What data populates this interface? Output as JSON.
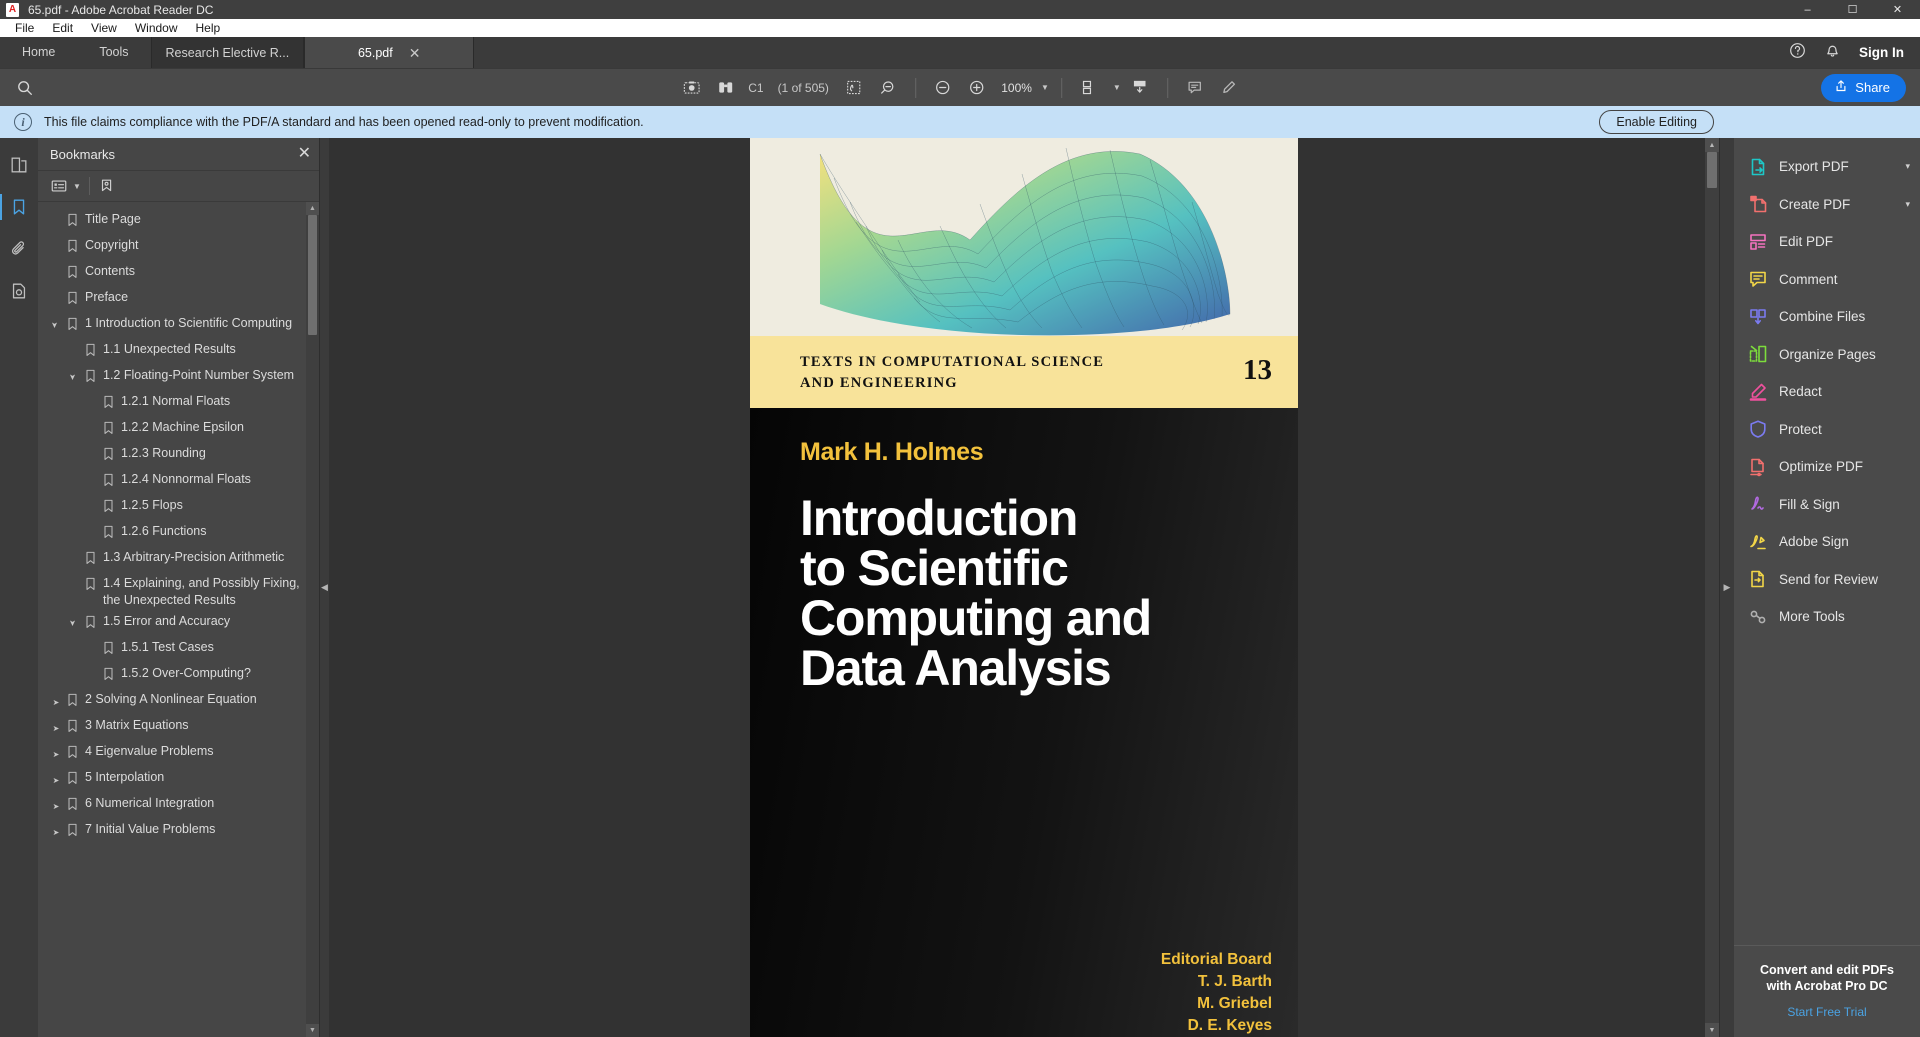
{
  "window": {
    "title": "65.pdf - Adobe Acrobat Reader DC",
    "app_icon": "adobe-acrobat-icon",
    "minimize": "–",
    "maximize": "☐",
    "close": "✕"
  },
  "menubar": {
    "items": [
      {
        "label": "File"
      },
      {
        "label": "Edit"
      },
      {
        "label": "View"
      },
      {
        "label": "Window"
      },
      {
        "label": "Help"
      }
    ]
  },
  "tabs": {
    "home": "Home",
    "tools": "Tools",
    "documents": [
      {
        "label": "Research Elective R...",
        "active": false
      },
      {
        "label": "65.pdf",
        "active": true,
        "close": "✕"
      }
    ],
    "help_icon": "question-circle-icon",
    "bell_icon": "notification-bell-icon",
    "signin": "Sign In"
  },
  "toolbar": {
    "search_icon": "search-icon",
    "snapshot_icon": "camera-snapshot-icon",
    "read_mode_icon": "binoculars-icon",
    "page_label": "C1",
    "page_count": "(1 of 505)",
    "pan_icon": "pan-select-icon",
    "zoom_select_icon": "marquee-zoom-icon",
    "zoom_out_icon": "zoom-out-icon",
    "zoom_in_icon": "zoom-in-icon",
    "zoom_value": "100%",
    "zoom_caret": "▼",
    "fit_icon": "fit-page-icon",
    "fit_caret": "▼",
    "scroll_icon": "scroll-mode-icon",
    "comment_icon": "comment-icon",
    "highlight_icon": "highlighter-icon",
    "share_icon": "share-icon",
    "share_label": "Share"
  },
  "notification": {
    "icon": "info-icon",
    "info_glyph": "i",
    "message": "This file claims compliance with the PDF/A standard and has been opened read-only to prevent modification.",
    "action_label": "Enable Editing"
  },
  "rail": {
    "items": [
      {
        "icon": "page-thumbnails-icon",
        "active": false
      },
      {
        "icon": "bookmarks-icon",
        "active": true
      },
      {
        "icon": "attachments-paperclip-icon",
        "active": false
      },
      {
        "icon": "document-info-icon",
        "active": false
      }
    ]
  },
  "bookmarks_panel": {
    "title": "Bookmarks",
    "close_icon": "close-icon",
    "options_icon": "bookmark-options-icon",
    "options_caret": "▼",
    "new_bookmark_icon": "new-bookmark-icon",
    "arrow_expanded": "⌄",
    "arrow_collapsed": "›",
    "flag_icon": "bookmark-flag-icon",
    "scroll_up": "▲",
    "scroll_down": "▼",
    "items": [
      {
        "label": "Title Page",
        "level": 0,
        "state": "leaf"
      },
      {
        "label": "Copyright",
        "level": 0,
        "state": "leaf"
      },
      {
        "label": "Contents",
        "level": 0,
        "state": "leaf"
      },
      {
        "label": "Preface",
        "level": 0,
        "state": "leaf"
      },
      {
        "label": "1 Introduction to Scientific Computing",
        "level": 0,
        "state": "expanded"
      },
      {
        "label": "1.1 Unexpected Results",
        "level": 1,
        "state": "leaf"
      },
      {
        "label": "1.2 Floating-Point Number System",
        "level": 1,
        "state": "expanded"
      },
      {
        "label": "1.2.1 Normal Floats",
        "level": 2,
        "state": "leaf"
      },
      {
        "label": "1.2.2 Machine Epsilon",
        "level": 2,
        "state": "leaf"
      },
      {
        "label": "1.2.3 Rounding",
        "level": 2,
        "state": "leaf"
      },
      {
        "label": "1.2.4 Nonnormal Floats",
        "level": 2,
        "state": "leaf"
      },
      {
        "label": "1.2.5 Flops",
        "level": 2,
        "state": "leaf"
      },
      {
        "label": "1.2.6 Functions",
        "level": 2,
        "state": "leaf"
      },
      {
        "label": "1.3 Arbitrary-Precision Arithmetic",
        "level": 1,
        "state": "leaf"
      },
      {
        "label": "1.4 Explaining, and Possibly Fixing, the Unexpected Results",
        "level": 1,
        "state": "leaf"
      },
      {
        "label": "1.5 Error and Accuracy",
        "level": 1,
        "state": "expanded"
      },
      {
        "label": "1.5.1 Test Cases",
        "level": 2,
        "state": "leaf"
      },
      {
        "label": "1.5.2 Over-Computing?",
        "level": 2,
        "state": "leaf"
      },
      {
        "label": "2 Solving A Nonlinear Equation",
        "level": 0,
        "state": "collapsed"
      },
      {
        "label": "3 Matrix Equations",
        "level": 0,
        "state": "collapsed"
      },
      {
        "label": "4 Eigenvalue Problems",
        "level": 0,
        "state": "collapsed"
      },
      {
        "label": "5 Interpolation",
        "level": 0,
        "state": "collapsed"
      },
      {
        "label": "6 Numerical Integration",
        "level": 0,
        "state": "collapsed"
      },
      {
        "label": "7 Initial Value Problems",
        "level": 0,
        "state": "collapsed"
      }
    ]
  },
  "panel_handle": {
    "collapse_icon": "◀"
  },
  "document": {
    "series_title": "TEXTS IN COMPUTATIONAL SCIENCE AND ENGINEERING",
    "series_line1": "TEXTS IN COMPUTATIONAL SCIENCE",
    "series_line2": "AND ENGINEERING",
    "series_number": "13",
    "author": "Mark H. Holmes",
    "title_line1": "Introduction",
    "title_line2": "to Scientific",
    "title_line3": "Computing and",
    "title_line4": "Data Analysis",
    "editorial_heading": "Editorial Board",
    "editors": [
      "T. J. Barth",
      "M. Griebel",
      "D. E. Keyes"
    ],
    "scroll_up": "▲",
    "scroll_down": "▼"
  },
  "tools_panel": {
    "expand_icon": "▶",
    "items": [
      {
        "label": "Export PDF",
        "icon": "export-pdf-icon",
        "color": "#1ec7c7",
        "chevron": "⌄"
      },
      {
        "label": "Create PDF",
        "icon": "create-pdf-icon",
        "color": "#f2706e",
        "chevron": "⌄"
      },
      {
        "label": "Edit PDF",
        "icon": "edit-pdf-icon",
        "color": "#f573c0",
        "chevron": ""
      },
      {
        "label": "Comment",
        "icon": "comment-icon",
        "color": "#f2d648",
        "chevron": ""
      },
      {
        "label": "Combine Files",
        "icon": "combine-files-icon",
        "color": "#7b7bf0",
        "chevron": ""
      },
      {
        "label": "Organize Pages",
        "icon": "organize-pages-icon",
        "color": "#7ddd3c",
        "chevron": ""
      },
      {
        "label": "Redact",
        "icon": "redact-icon",
        "color": "#f0519e",
        "chevron": ""
      },
      {
        "label": "Protect",
        "icon": "protect-shield-icon",
        "color": "#7b7bf0",
        "chevron": ""
      },
      {
        "label": "Optimize PDF",
        "icon": "optimize-pdf-icon",
        "color": "#f2706e",
        "chevron": ""
      },
      {
        "label": "Fill & Sign",
        "icon": "fill-and-sign-icon",
        "color": "#b36ae2",
        "chevron": ""
      },
      {
        "label": "Adobe Sign",
        "icon": "adobe-sign-icon",
        "color": "#f2d648",
        "chevron": ""
      },
      {
        "label": "Send for Review",
        "icon": "send-for-review-icon",
        "color": "#f2d648",
        "chevron": ""
      },
      {
        "label": "More Tools",
        "icon": "more-tools-icon",
        "color": "#b0b0b0",
        "chevron": ""
      }
    ],
    "promo_line1": "Convert and edit PDFs",
    "promo_line2": "with Acrobat Pro DC",
    "promo_link": "Start Free Trial"
  },
  "colors": {
    "accent_blue": "#1473e6",
    "notification_bg": "#c5e0f7",
    "link_blue": "#4ba3e3",
    "cover_yellow": "#f8e39a",
    "cover_author": "#f2c13c"
  }
}
